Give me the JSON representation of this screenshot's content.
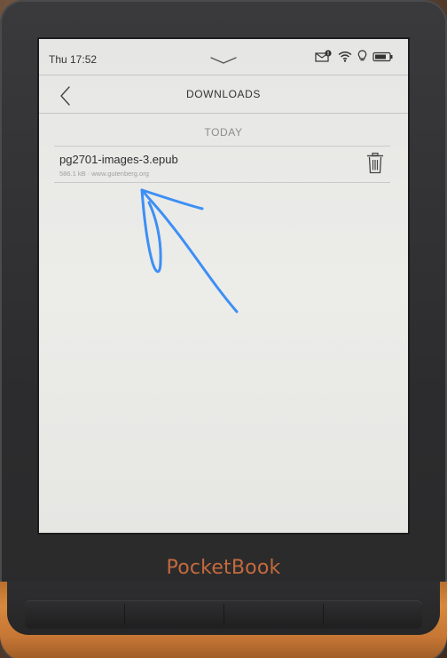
{
  "status_bar": {
    "time": "Thu 17:52",
    "icons": [
      "notification-mail-icon",
      "wifi-icon",
      "lightbulb-icon",
      "battery-icon"
    ]
  },
  "header": {
    "title": "DOWNLOADS",
    "back_icon": "chevron-left-icon"
  },
  "section": {
    "label": "TODAY"
  },
  "downloads": [
    {
      "name": "pg2701-images-3.epub",
      "meta": "586.1 kB · www.gutenberg.org",
      "action_icon": "trash-icon"
    }
  ],
  "device": {
    "brand": "PocketBook"
  },
  "colors": {
    "annotation_arrow": "#3d8ff5",
    "brand_text": "#c46a3c",
    "screen_bg": "#e8e8e6"
  }
}
